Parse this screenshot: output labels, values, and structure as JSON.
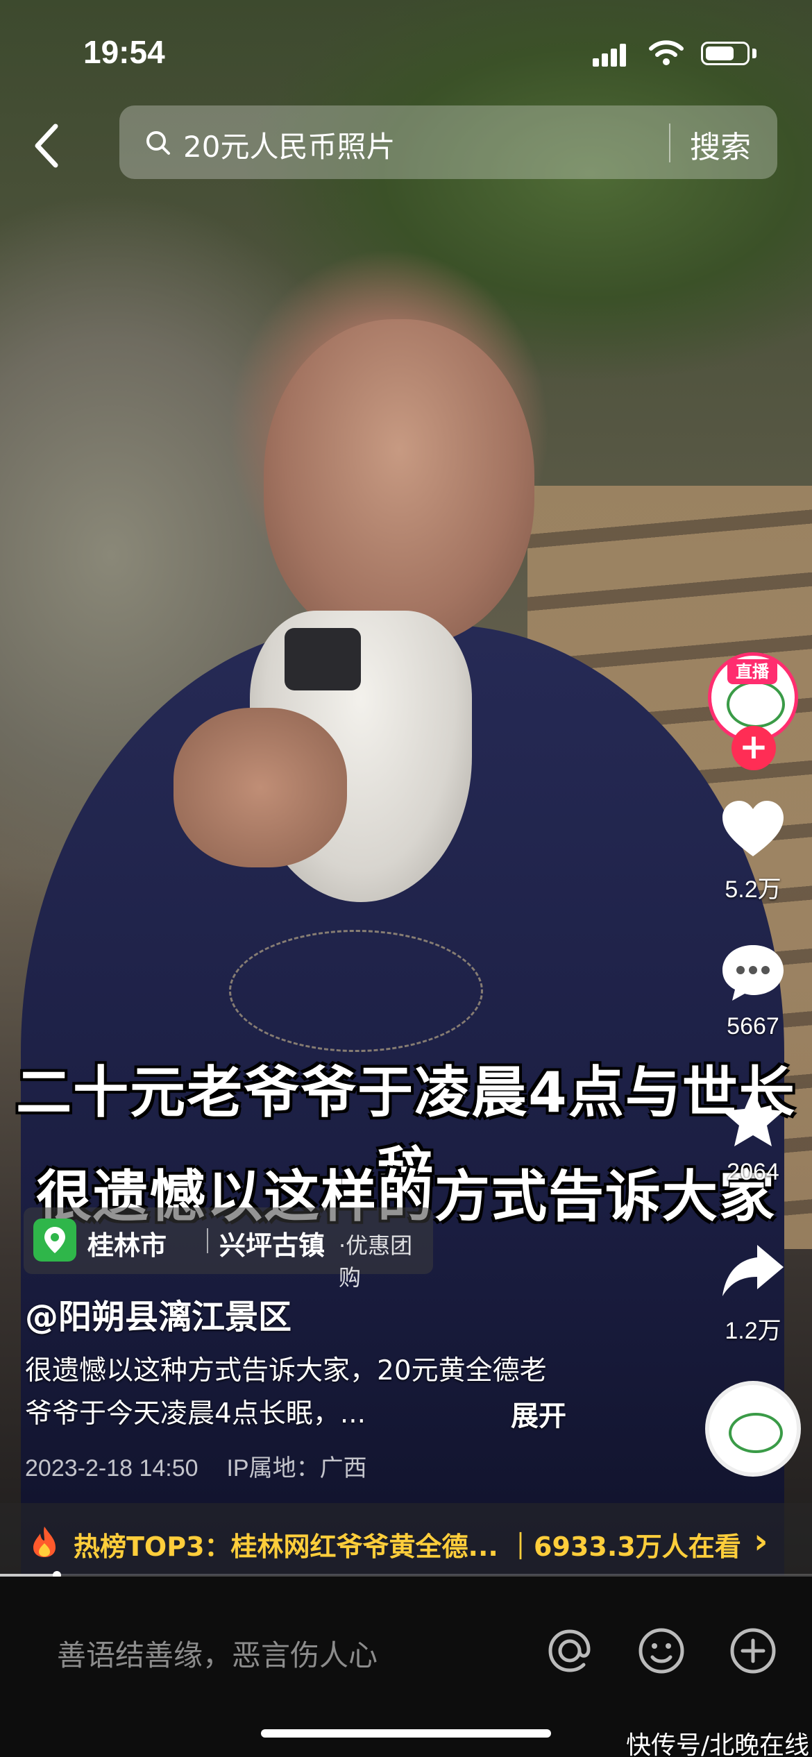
{
  "status_bar": {
    "time": "19:54",
    "battery_level": 0.72
  },
  "search": {
    "query": "20元人民币照片",
    "button": "搜索"
  },
  "video": {
    "caption_line1": "二十元老爷爷于凌晨4点与世长辞",
    "caption_line2": "很遗憾以这样的方式告诉大家",
    "live_tag": "直播",
    "playback_progress": 0.07
  },
  "actions": {
    "likes": "5.2万",
    "comments": "5667",
    "favorites": "2064",
    "shares": "1.2万"
  },
  "location": {
    "city": "桂林市",
    "town": "兴坪古镇",
    "deal": "·优惠团购"
  },
  "post": {
    "author": "@阳朔县漓江景区",
    "description": "很遗憾以这种方式告诉大家，20元黄全德老爷爷于今天凌晨4点长眠，...",
    "expand": "展开",
    "date": "2023-2-18 14:50",
    "ip": "IP属地：广西"
  },
  "hot": {
    "text": "热榜TOP3：桂林网红爷爷黄全德... ｜6933.3万人在看"
  },
  "comment_bar": {
    "placeholder": "善语结善缘，恶言伤人心"
  },
  "watermark": "快传号/北晚在线",
  "colors": {
    "accent_pink": "#ff2d55",
    "hot_yellow": "#ffce3b",
    "map_green": "#2fb64a"
  }
}
